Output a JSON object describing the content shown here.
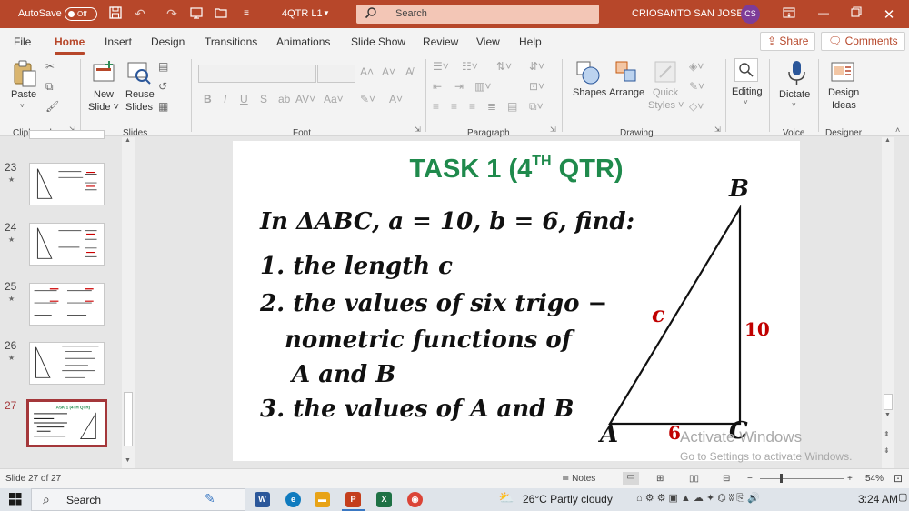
{
  "titlebar": {
    "autosave_label": "AutoSave",
    "autosave_state": "Off",
    "document_name": "4QTR L1",
    "search_placeholder": "Search",
    "user_name": "CRIOSANTO SAN JOSE",
    "user_initials": "CS"
  },
  "tabs": [
    "File",
    "Home",
    "Insert",
    "Design",
    "Transitions",
    "Animations",
    "Slide Show",
    "Review",
    "View",
    "Help"
  ],
  "active_tab": "Home",
  "share_label": "Share",
  "comments_label": "Comments",
  "ribbon": {
    "paste": "Paste",
    "new_slide": "New\nSlide",
    "new_slide_l1": "New",
    "new_slide_l2": "Slide ˅",
    "reuse_l1": "Reuse",
    "reuse_l2": "Slides",
    "shapes": "Shapes",
    "arrange": "Arrange",
    "quick_l1": "Quick",
    "quick_l2": "Styles ˅",
    "editing": "Editing",
    "dictate": "Dictate",
    "design_l1": "Design",
    "design_l2": "Ideas",
    "groups": {
      "clipboard": "Clipboard",
      "slides": "Slides",
      "font": "Font",
      "paragraph": "Paragraph",
      "drawing": "Drawing",
      "voice": "Voice",
      "designer": "Designer"
    }
  },
  "thumbnails": [
    {
      "number": "23"
    },
    {
      "number": "24"
    },
    {
      "number": "25"
    },
    {
      "number": "26"
    },
    {
      "number": "27"
    }
  ],
  "slide": {
    "title_main": "TASK 1 (4",
    "title_sup": "TH",
    "title_end": " QTR)",
    "line1": "In ΔABC, a = 10, b = 6, find:",
    "line2": "1. the length c",
    "line3": "2. the values of six trigo −",
    "line4": "nometric functions of",
    "line5": "A and B",
    "line6": "3. the values of A and B",
    "vertex_a": "A",
    "vertex_b": "B",
    "vertex_c": "C",
    "side_c": "c",
    "side_a": "10",
    "side_b": "6"
  },
  "watermark": {
    "line1": "Activate Windows",
    "line2": "Go to Settings to activate Windows."
  },
  "status": {
    "slide_info": "Slide 27 of 27",
    "notes": "Notes",
    "zoom": "54%"
  },
  "taskbar": {
    "search": "Search",
    "weather": "26°C  Partly cloudy",
    "time": "3:24 AM"
  },
  "colors": {
    "accent": "#b7472a",
    "title_green": "#1f8a4c",
    "red_label": "#c00000"
  }
}
